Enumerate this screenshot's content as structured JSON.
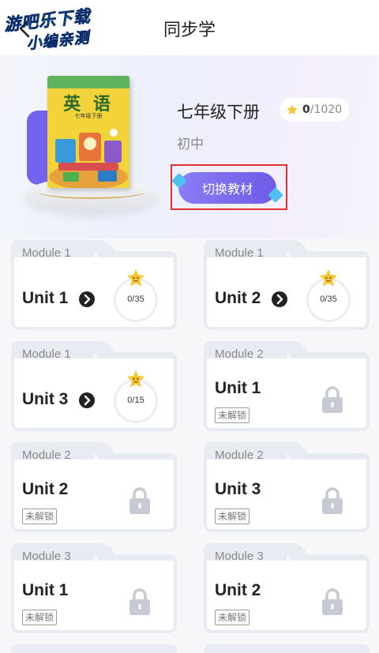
{
  "header": {
    "title": "同步学",
    "watermark_line1": "游吧乐下载",
    "watermark_line2": "小编亲测"
  },
  "book": {
    "cover_title": "英 语",
    "cover_subtitle": "七年级下册",
    "grade": "七年级下册",
    "level": "初中",
    "stars": "0",
    "stars_total": "/1020",
    "switch_label": "切换教材"
  },
  "colors": {
    "accent": "#7264f0",
    "star": "#f7c531",
    "lock": "#c7cad3"
  },
  "cards": [
    {
      "module": "Module 1",
      "unit": "Unit 1",
      "status": "open",
      "progress": "0/35"
    },
    {
      "module": "Module 1",
      "unit": "Unit 2",
      "status": "open",
      "progress": "0/35"
    },
    {
      "module": "Module 1",
      "unit": "Unit 3",
      "status": "open",
      "progress": "0/15"
    },
    {
      "module": "Module 2",
      "unit": "Unit 1",
      "status": "locked",
      "locked_label": "未解锁"
    },
    {
      "module": "Module 2",
      "unit": "Unit 2",
      "status": "locked",
      "locked_label": "未解锁"
    },
    {
      "module": "Module 2",
      "unit": "Unit 3",
      "status": "locked",
      "locked_label": "未解锁"
    },
    {
      "module": "Module 3",
      "unit": "Unit 1",
      "status": "locked",
      "locked_label": "未解锁"
    },
    {
      "module": "Module 3",
      "unit": "Unit 2",
      "status": "locked",
      "locked_label": "未解锁"
    }
  ]
}
